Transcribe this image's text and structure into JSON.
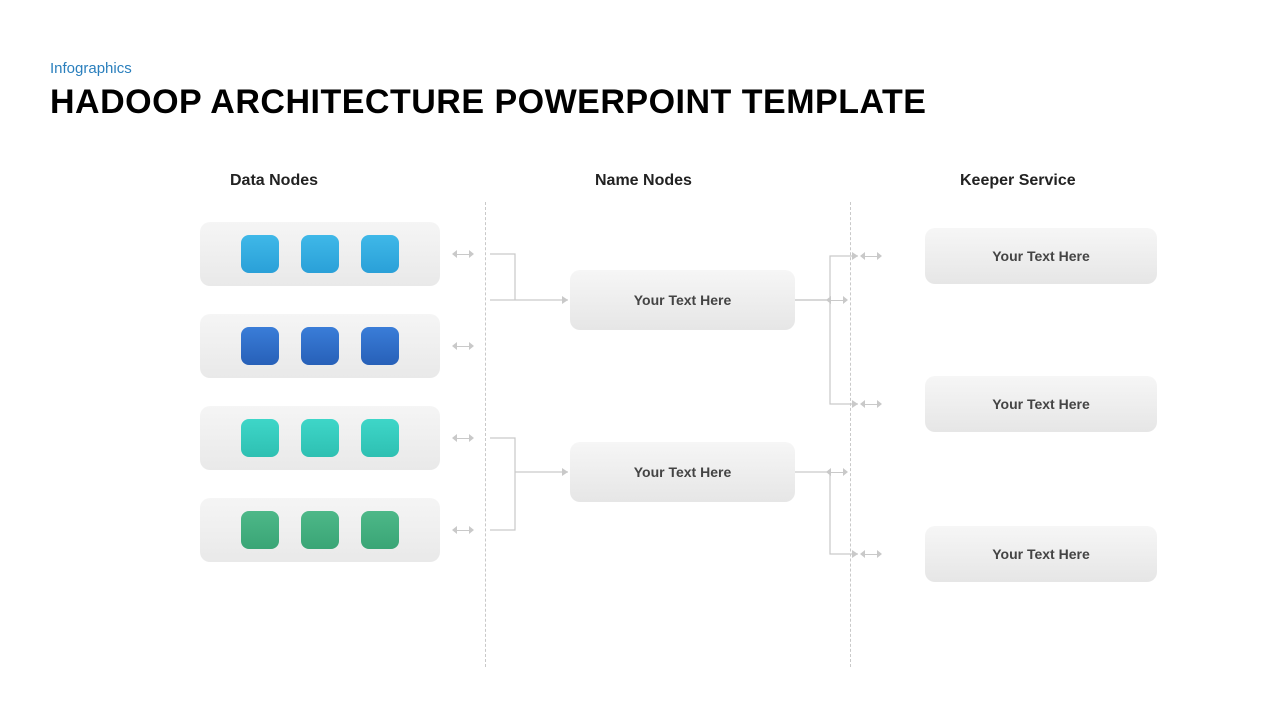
{
  "header": {
    "category": "Infographics",
    "title": "HADOOP ARCHITECTURE POWERPOINT TEMPLATE"
  },
  "columns": {
    "data_nodes": "Data Nodes",
    "name_nodes": "Name Nodes",
    "keeper_service": "Keeper Service"
  },
  "name_boxes": [
    "Your Text Here",
    "Your Text Here"
  ],
  "keeper_boxes": [
    "Your Text Here",
    "Your Text Here",
    "Your Text Here"
  ],
  "colors": {
    "row1": "#3fb8e8",
    "row2": "#3a7dd8",
    "row3": "#3ed6c8",
    "row4": "#4db888"
  }
}
